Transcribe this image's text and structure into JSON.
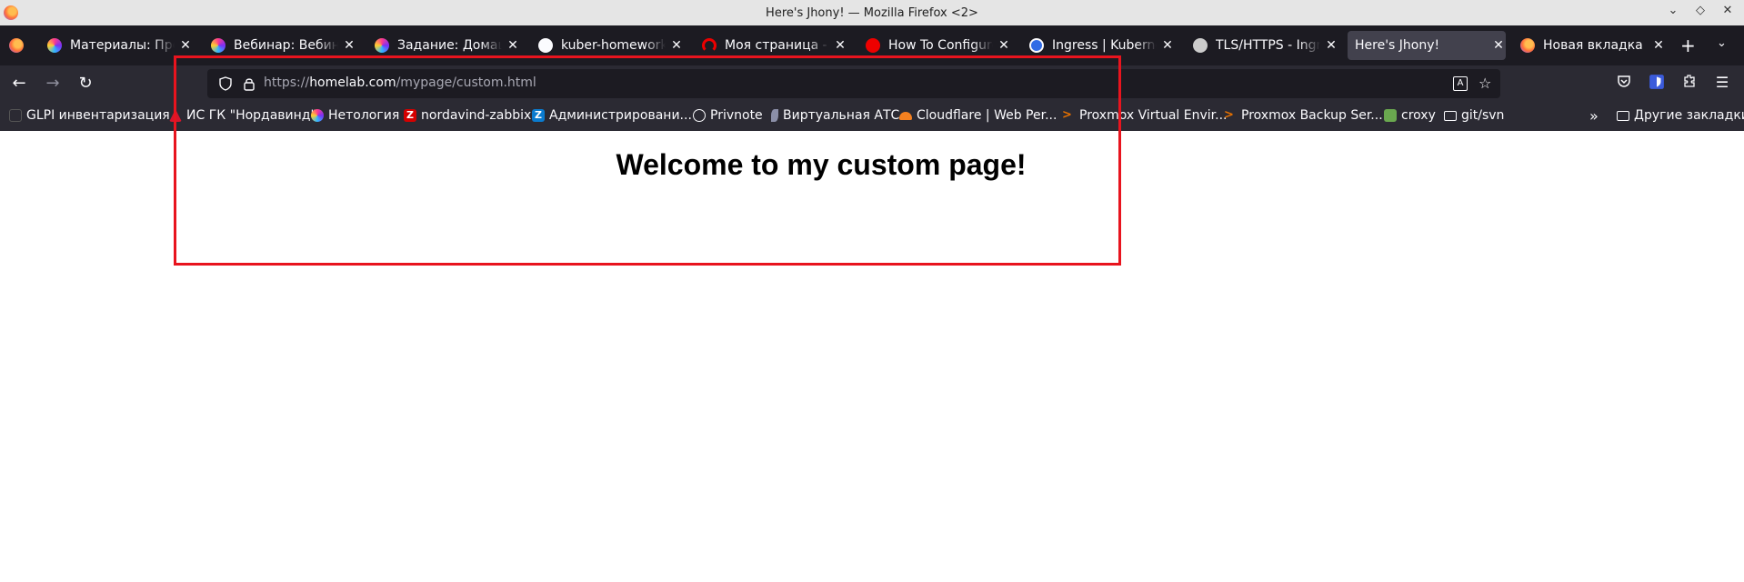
{
  "window": {
    "title": "Here's Jhony! — Mozilla Firefox <2>"
  },
  "tabs": [
    {
      "label": "Материалы: Презентация",
      "icon": "netology-icon",
      "color": "#7b2ff7"
    },
    {
      "label": "Вебинар: Вебинар",
      "icon": "netology-icon",
      "color": "#7b2ff7"
    },
    {
      "label": "Задание: Домашнее",
      "icon": "netology-icon",
      "color": "#7b2ff7"
    },
    {
      "label": "kuber-homeworks/",
      "icon": "github-icon",
      "color": "#ffffff"
    },
    {
      "label": "Моя страница - Информация",
      "icon": "redhat-icon",
      "color": "#ee0000"
    },
    {
      "label": "How To Configure Ingress",
      "icon": "redhat-icon",
      "color": "#ee0000"
    },
    {
      "label": "Ingress | Kubernetes",
      "icon": "kubernetes-icon",
      "color": "#326ce5"
    },
    {
      "label": "TLS/HTTPS - Ingress",
      "icon": "nginx-icon",
      "color": "#cccccc"
    },
    {
      "label": "Here's Jhony!",
      "icon": "",
      "color": "",
      "active": true
    },
    {
      "label": "Новая вкладка",
      "icon": "firefox-icon",
      "color": "#ff7139"
    }
  ],
  "url": {
    "prefix": "https://",
    "host": "homelab.com",
    "path": "/mypage/custom.html"
  },
  "bookmarks": [
    {
      "label": "GLPI инвентаризация",
      "icon": "glpi-icon",
      "color": "#2b2a33"
    },
    {
      "label": "ИС ГК \"Нордавинд\"",
      "icon": "nordavind-icon",
      "color": "#d6162d"
    },
    {
      "label": "Нетология",
      "icon": "netology-icon",
      "color": "#7b2ff7"
    },
    {
      "label": "nordavind-zabbix",
      "icon": "zabbix-icon",
      "color": "#d40000"
    },
    {
      "label": "Администрировани...",
      "icon": "zabbix-icon",
      "color": "#0a7bcf"
    },
    {
      "label": "Privnote",
      "icon": "globe-icon",
      "color": "#2b2a33"
    },
    {
      "label": "Виртуальная АТС",
      "icon": "feather-icon",
      "color": "#8b8fa8"
    },
    {
      "label": "Cloudflare | Web Per...",
      "icon": "cloudflare-icon",
      "color": "#f38020"
    },
    {
      "label": "Proxmox Virtual Envir...",
      "icon": "proxmox-icon",
      "color": "#e57000"
    },
    {
      "label": "Proxmox Backup Ser...",
      "icon": "proxmox-icon",
      "color": "#e57000"
    },
    {
      "label": "croxy",
      "icon": "croxy-icon",
      "color": "#6aa84f"
    },
    {
      "label": "git/svn",
      "icon": "folder-icon",
      "color": "#2b2a33"
    }
  ],
  "bookmarks_other": "Другие закладки",
  "page": {
    "heading": "Welcome to my custom page!"
  },
  "annotation": {
    "color": "#e8141e"
  }
}
